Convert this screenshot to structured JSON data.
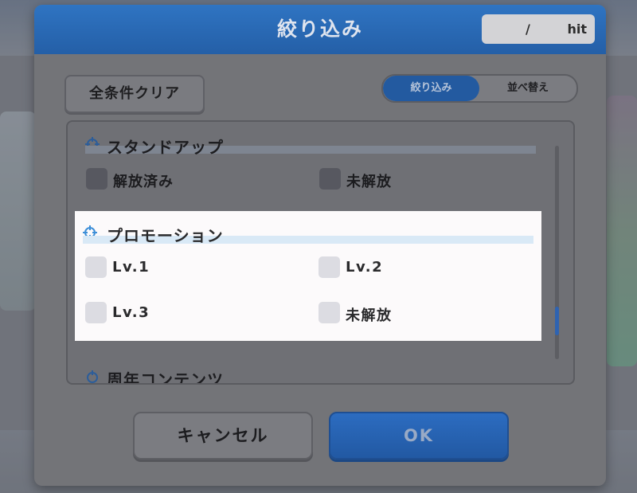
{
  "dialog": {
    "title": "絞り込み",
    "hit": {
      "separator": "/",
      "label": "hit"
    },
    "clear_all_label": "全条件クリア",
    "tabs": [
      {
        "label": "絞り込み",
        "active": true
      },
      {
        "label": "並べ替え",
        "active": false
      }
    ],
    "sections": [
      {
        "title": "スタンドアップ",
        "options": [
          "解放済み",
          "未解放"
        ]
      },
      {
        "title": "プロモーション",
        "options": [
          "Lv.1",
          "Lv.2",
          "Lv.3",
          "未解放"
        ]
      },
      {
        "title": "周年コンテンツ"
      }
    ],
    "cancel_label": "キャンセル",
    "ok_label": "OK"
  },
  "colors": {
    "header_blue": "#2f74c2",
    "ok_blue": "#2c6cc0",
    "highlight_bg": "#fcfafb",
    "highlight_bar": "#d9e9f6",
    "icon_blue": "#3d8fd8"
  }
}
